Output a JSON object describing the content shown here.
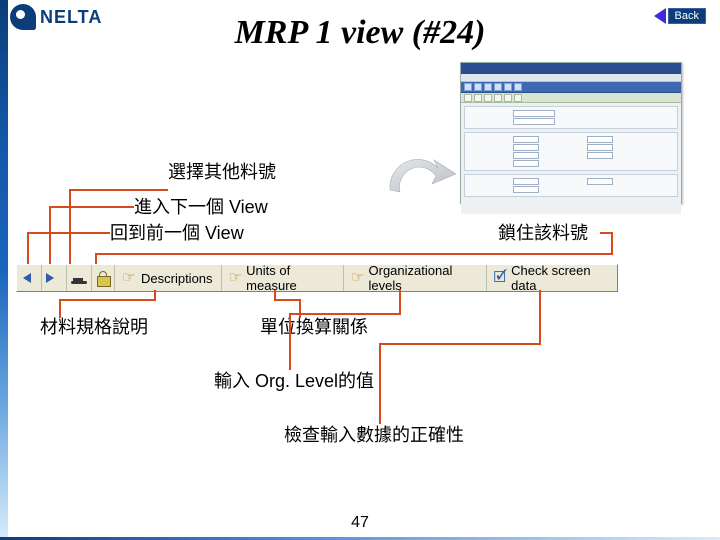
{
  "header": {
    "logo_text": "NELTA",
    "title": "MRP 1 view (#24)",
    "back_label": "Back"
  },
  "annotations": {
    "select_other_material": "選擇其他料號",
    "next_view": "進入下一個 View",
    "prev_view": "回到前一個 View",
    "lock_material": "鎖住該料號",
    "material_spec": "材料規格說明",
    "unit_relation": "單位換算關係",
    "org_level_input": "輸入 Org. Level的值",
    "check_input": "檢查輸入數據的正確性"
  },
  "toolbar": {
    "descriptions": "Descriptions",
    "units": "Units of measure",
    "org_levels": "Organizational levels",
    "check_data": "Check screen data"
  },
  "slide_number": "47"
}
